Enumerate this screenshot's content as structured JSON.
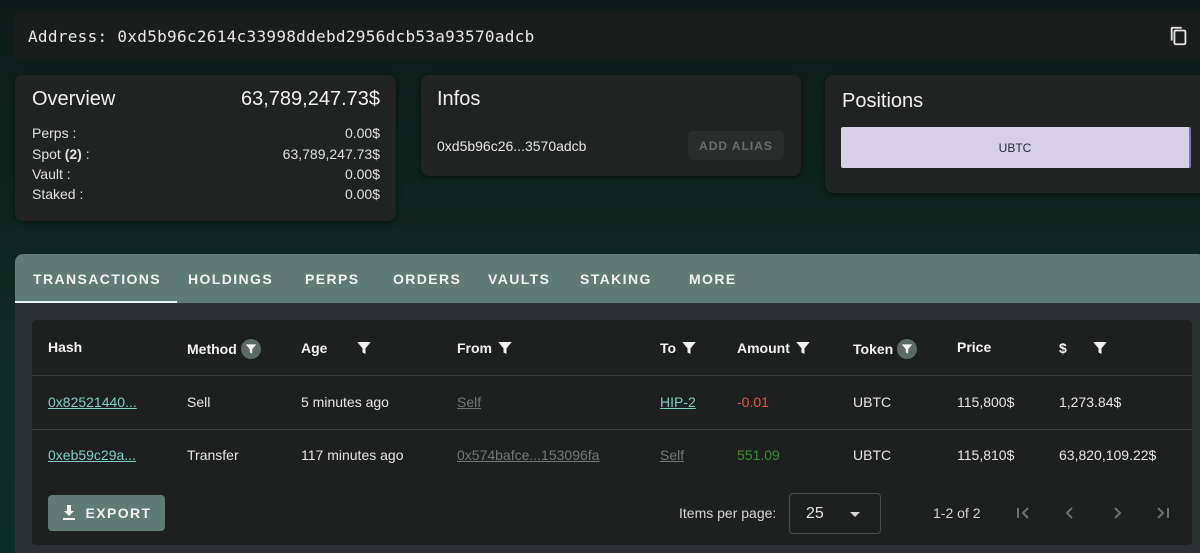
{
  "address_bar": {
    "text": "Address: 0xd5b96c2614c33998ddebd2956dcb53a93570adcb"
  },
  "overview": {
    "title": "Overview",
    "total": "63,789,247.73$",
    "rows": [
      {
        "label": "Perps :",
        "value": "0.00$"
      },
      {
        "label_prefix": "Spot ",
        "label_bold": "(2)",
        "label_suffix": " :",
        "value": "63,789,247.73$"
      },
      {
        "label": "Vault :",
        "value": "0.00$"
      },
      {
        "label": "Staked :",
        "value": "0.00$"
      }
    ]
  },
  "infos": {
    "title": "Infos",
    "short_address": "0xd5b96c26...3570adcb",
    "alias_button": "ADD ALIAS"
  },
  "positions": {
    "title": "Positions",
    "items": [
      {
        "label": "UBTC"
      }
    ]
  },
  "tabs": [
    "TRANSACTIONS",
    "HOLDINGS",
    "PERPS",
    "ORDERS",
    "VAULTS",
    "STAKING",
    "MORE"
  ],
  "table": {
    "columns": [
      "Hash",
      "Method",
      "Age",
      "From",
      "To",
      "Amount",
      "Token",
      "Price",
      "$"
    ],
    "rows": [
      {
        "hash": "0x82521440...",
        "method": "Sell",
        "age": "5 minutes ago",
        "from": "Self",
        "to": "HIP-2",
        "amount": "-0.01",
        "token": "UBTC",
        "price": "115,800$",
        "usd": "1,273.84$"
      },
      {
        "hash": "0xeb59c29a...",
        "method": "Transfer",
        "age": "117 minutes ago",
        "from": "0x574bafce...153096fa",
        "to": "Self",
        "amount": "551.09",
        "token": "UBTC",
        "price": "115,810$",
        "usd": "63,820,109.22$"
      }
    ]
  },
  "footer": {
    "export_label": "EXPORT",
    "items_per_page_label": "Items per page:",
    "items_per_page_value": "25",
    "range": "1-2 of 2"
  },
  "colors": {
    "accent": "#5f7b74",
    "negative": "#e2574c",
    "positive": "#3f8a3a",
    "link": "#7fcfc0"
  }
}
